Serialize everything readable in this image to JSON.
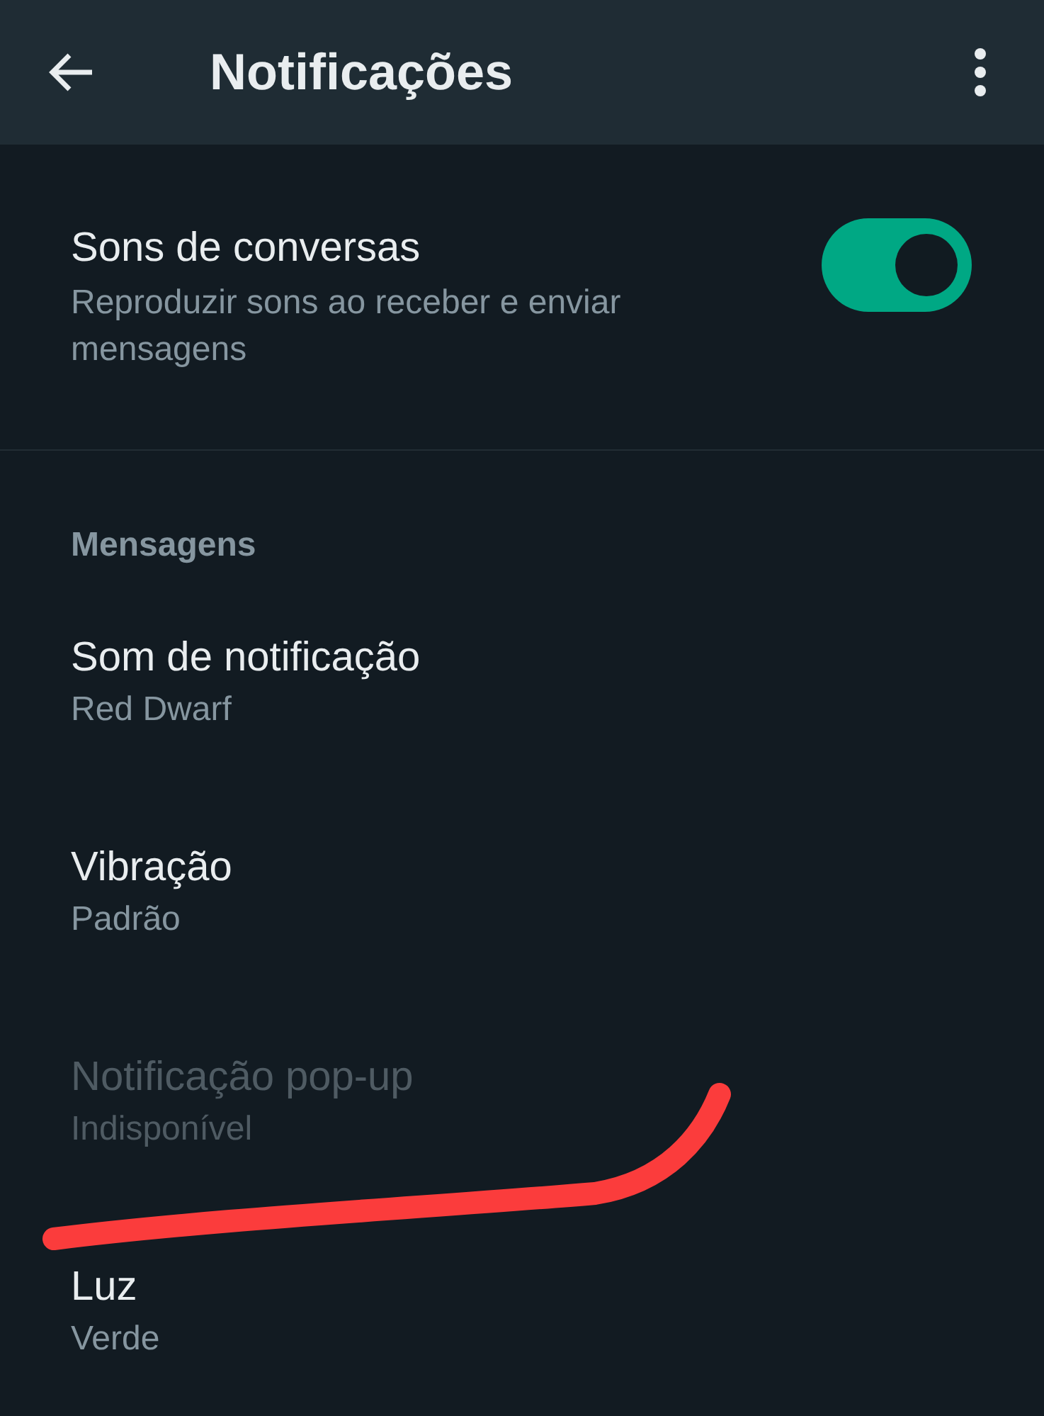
{
  "app_bar": {
    "title": "Notificações"
  },
  "conversation_sounds": {
    "title": "Sons de conversas",
    "subtitle": "Reproduzir sons ao receber e enviar mensagens",
    "on": true
  },
  "sections": [
    {
      "header": "Mensagens",
      "items": [
        {
          "title": "Som de notificação",
          "value": "Red Dwarf",
          "disabled": false
        },
        {
          "title": "Vibração",
          "value": "Padrão",
          "disabled": false
        },
        {
          "title": "Notificação pop-up",
          "value": "Indisponível",
          "disabled": true
        },
        {
          "title": "Luz",
          "value": "Verde",
          "disabled": false
        }
      ]
    }
  ]
}
